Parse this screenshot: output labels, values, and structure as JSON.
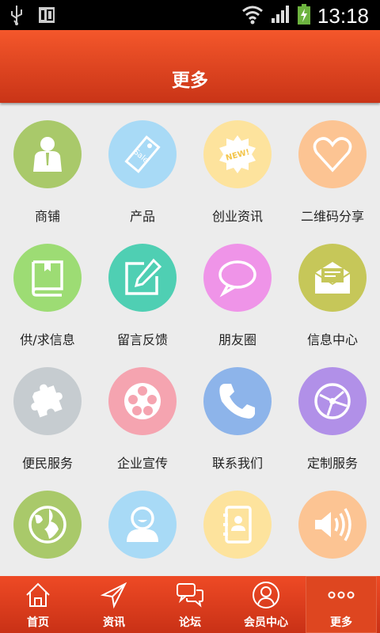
{
  "status_bar": {
    "time": "13:18"
  },
  "header": {
    "title": "更多"
  },
  "grid": [
    {
      "label": "商铺",
      "icon": "shop-owner-icon",
      "color": "#a9c96a"
    },
    {
      "label": "产品",
      "icon": "sale-tag-icon",
      "color": "#a8daf6"
    },
    {
      "label": "创业资讯",
      "icon": "new-badge-icon",
      "color": "#fde39d"
    },
    {
      "label": "二维码分享",
      "icon": "heart-icon",
      "color": "#fcc493"
    },
    {
      "label": "供/求信息",
      "icon": "book-icon",
      "color": "#9ddc74"
    },
    {
      "label": "留言反馈",
      "icon": "edit-icon",
      "color": "#4fcfb3"
    },
    {
      "label": "朋友圈",
      "icon": "chat-bubble-icon",
      "color": "#ef94e8"
    },
    {
      "label": "信息中心",
      "icon": "mail-icon",
      "color": "#c6c759"
    },
    {
      "label": "便民服务",
      "icon": "puzzle-icon",
      "color": "#c6ccd0"
    },
    {
      "label": "企业宣传",
      "icon": "film-reel-icon",
      "color": "#f5a4b0"
    },
    {
      "label": "联系我们",
      "icon": "phone-icon",
      "color": "#8db4ea"
    },
    {
      "label": "定制服务",
      "icon": "network-icon",
      "color": "#b190e8"
    },
    {
      "label": "",
      "icon": "globe-icon",
      "color": "#a9c96a"
    },
    {
      "label": "",
      "icon": "user-icon",
      "color": "#a8daf6"
    },
    {
      "label": "",
      "icon": "contacts-book-icon",
      "color": "#fde39d"
    },
    {
      "label": "",
      "icon": "speaker-icon",
      "color": "#fcc493"
    }
  ],
  "tabbar": [
    {
      "label": "首页",
      "icon": "home-icon"
    },
    {
      "label": "资讯",
      "icon": "send-icon"
    },
    {
      "label": "论坛",
      "icon": "forum-icon"
    },
    {
      "label": "会员中心",
      "icon": "member-icon"
    },
    {
      "label": "更多",
      "icon": "more-icon",
      "active": true
    }
  ]
}
